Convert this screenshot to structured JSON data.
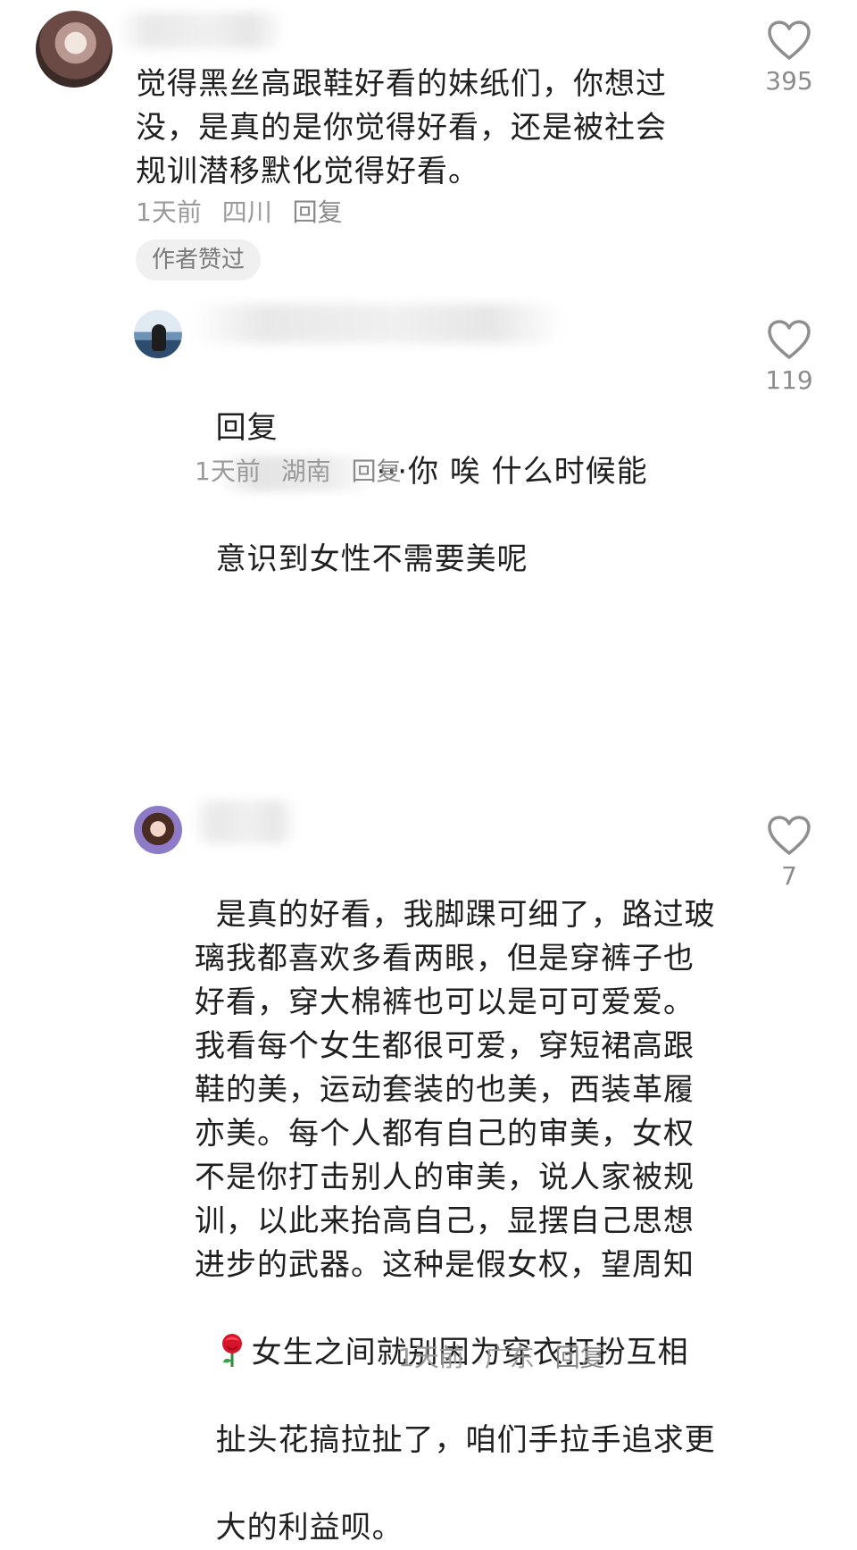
{
  "comments": [
    {
      "text": "觉得黑丝高跟鞋好看的妹纸们，你想过\n没，是真的是你觉得好看，还是被社会\n规训潜移默化觉得好看。",
      "time": "1天前",
      "location": "四川",
      "reply": "回复",
      "badge": "作者赞过",
      "likes": "395"
    },
    {
      "reply_prefix": "回复",
      "text_line1_tail": "···你 唉 什么时候能",
      "text_line2": "意识到女性不需要美呢",
      "time": "1天前",
      "location": "湖南",
      "reply": "回复",
      "likes": "119"
    },
    {
      "text": "是真的好看，我脚踝可细了，路过玻\n璃我都喜欢多看两眼，但是穿裤子也\n好看，穿大棉裤也可以是可可爱爱。\n我看每个女生都很可爱，穿短裙高跟\n鞋的美，运动套装的也美，西装革履\n亦美。每个人都有自己的审美，女权\n不是你打击别人的审美，说人家被规\n训，以此来抬高自己，显摆自己思想\n进步的武器。这种是假女权，望周知",
      "text_emoji_line": "女生之间就别因为穿衣打扮互相",
      "text_line_after": "扯头花搞拉扯了，咱们手拉手追求更",
      "text_last": "大的利益呗。",
      "time": "1天前",
      "location": "广东",
      "reply": "回复",
      "likes": "7"
    }
  ],
  "icons": {
    "like": "heart-outline-icon",
    "emoji": "rose-emoji-icon"
  },
  "colors": {
    "text": "#1f1f1f",
    "meta": "#9a9a9a",
    "badge_bg": "#f0f0f0"
  }
}
